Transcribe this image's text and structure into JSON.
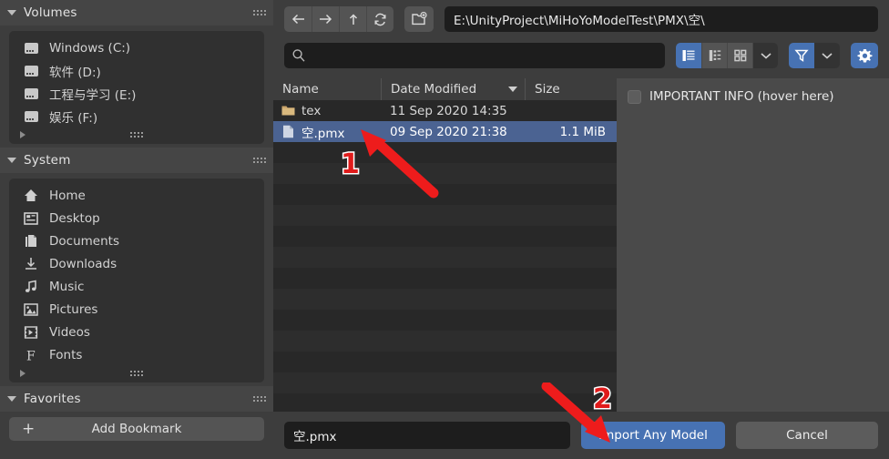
{
  "sidebar": {
    "sections": [
      {
        "title": "Volumes",
        "items": [
          {
            "label": "Windows (C:)",
            "icon": "drive-icon"
          },
          {
            "label": "软件 (D:)",
            "icon": "drive-icon"
          },
          {
            "label": "工程与学习 (E:)",
            "icon": "drive-icon"
          },
          {
            "label": "娱乐 (F:)",
            "icon": "drive-icon"
          }
        ]
      },
      {
        "title": "System",
        "items": [
          {
            "label": "Home",
            "icon": "home-icon"
          },
          {
            "label": "Desktop",
            "icon": "desktop-icon"
          },
          {
            "label": "Documents",
            "icon": "documents-icon"
          },
          {
            "label": "Downloads",
            "icon": "download-icon"
          },
          {
            "label": "Music",
            "icon": "music-note-icon"
          },
          {
            "label": "Pictures",
            "icon": "picture-icon"
          },
          {
            "label": "Videos",
            "icon": "film-icon"
          },
          {
            "label": "Fonts",
            "icon": "font-icon"
          }
        ]
      },
      {
        "title": "Favorites",
        "items": []
      }
    ],
    "add_bookmark_label": "Add Bookmark",
    "add_bookmark_plus": "+"
  },
  "toolbar": {
    "back_icon": "arrow-left-icon",
    "forward_icon": "arrow-right-icon",
    "up_icon": "arrow-up-icon",
    "refresh_icon": "refresh-icon",
    "new_folder_icon": "new-folder-icon",
    "path_value": "E:\\UnityProject\\MiHoYoModelTest\\PMX\\空\\"
  },
  "filterbar": {
    "search_icon": "search-icon",
    "search_value": "",
    "search_placeholder": "",
    "view_modes": [
      {
        "name": "vertical-list-view",
        "active": true
      },
      {
        "name": "horizontal-list-view",
        "active": false
      },
      {
        "name": "thumbnail-grid-view",
        "active": false
      }
    ],
    "display_chevron_icon": "chevron-down-icon",
    "filter_icon": "funnel-icon",
    "filter_active": true,
    "filter_chevron_icon": "chevron-down-icon",
    "settings_icon": "gear-icon"
  },
  "filelist": {
    "columns": [
      {
        "label": "Name",
        "sorted": false
      },
      {
        "label": "Date Modified",
        "sorted": true,
        "sort_icon": "triangle-down-icon"
      },
      {
        "label": "Size",
        "sorted": false
      }
    ],
    "rows": [
      {
        "name": "tex",
        "date": "11 Sep 2020 14:35",
        "size": "",
        "icon": "folder-icon",
        "selected": false
      },
      {
        "name": "空.pmx",
        "date": "09 Sep 2020 21:38",
        "size": "1.1 MiB",
        "icon": "file-icon",
        "selected": true
      }
    ],
    "empty_row_count": 14
  },
  "info_panel": {
    "checkbox_label": "IMPORTANT INFO (hover here)",
    "checkbox_checked": false
  },
  "bottombar": {
    "filename_value": "空.pmx",
    "import_label": "Import Any Model",
    "cancel_label": "Cancel",
    "scroll_up_icon": "chevron-up-icon"
  },
  "annotations": [
    {
      "label": "1",
      "target": "selected-file-row"
    },
    {
      "label": "2",
      "target": "import-button"
    }
  ],
  "colors": {
    "accent_blue": "#4772b3",
    "selection_blue": "#4b6392",
    "annotation_red": "#e01b1b",
    "panel_bg": "#3d3d3d",
    "list_bg": "#282828",
    "info_bg": "#4a4a4a"
  }
}
